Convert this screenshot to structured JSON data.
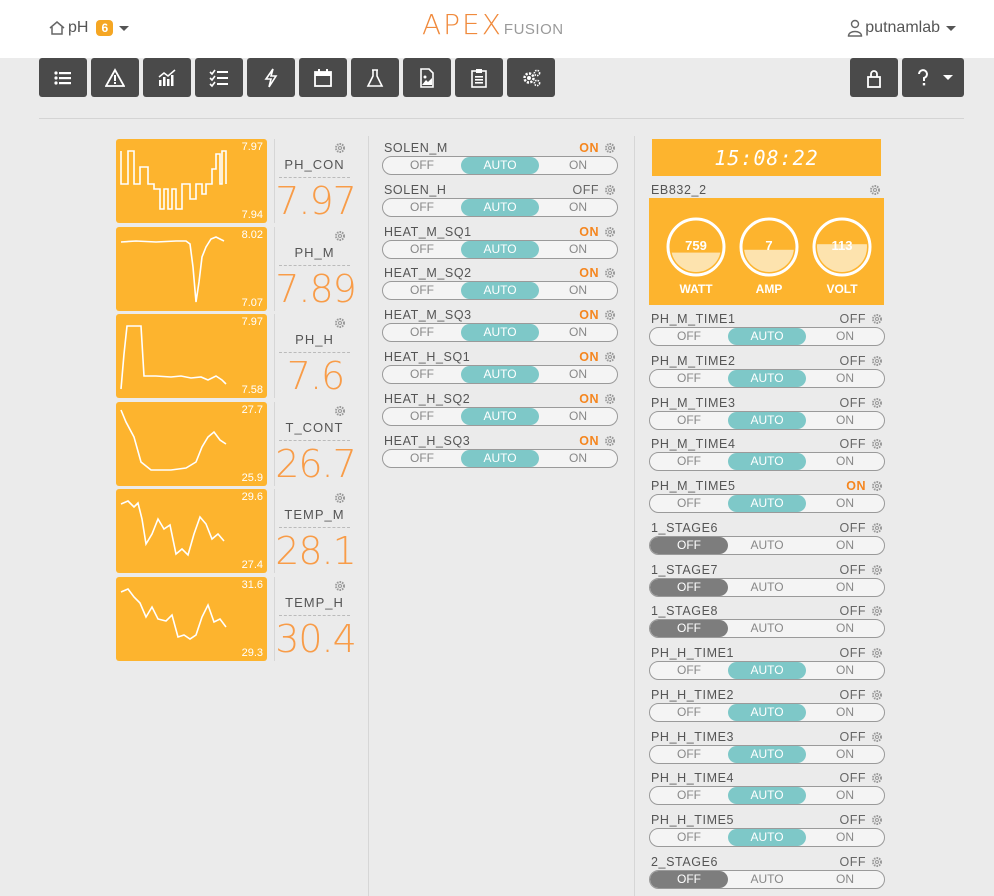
{
  "nav": {
    "site_name": "pH",
    "alert_count": "6",
    "logo_main": "APEX",
    "logo_sub": "FUSION",
    "username": "putnamlab"
  },
  "toolbar": {
    "left_icons": [
      "list-icon",
      "warning-icon",
      "chart-icon",
      "checklist-icon",
      "bolt-icon",
      "calendar-icon",
      "flask-icon",
      "document-image-icon",
      "clipboard-icon",
      "cogs-icon"
    ],
    "right_icons": [
      "lock-icon",
      "help-icon"
    ]
  },
  "probes": [
    {
      "name": "PH_CON",
      "value": "7.97",
      "max": "7.97",
      "min": "7.94"
    },
    {
      "name": "PH_M",
      "value": "7.89",
      "max": "8.02",
      "min": "7.07"
    },
    {
      "name": "PH_H",
      "value": "7.6",
      "max": "7.97",
      "min": "7.58"
    },
    {
      "name": "T_CONT",
      "value": "26.7",
      "max": "27.7",
      "min": "25.9"
    },
    {
      "name": "TEMP_M",
      "value": "28.1",
      "max": "29.6",
      "min": "27.4"
    },
    {
      "name": "TEMP_H",
      "value": "30.4",
      "max": "31.6",
      "min": "29.3"
    }
  ],
  "switch_labels": {
    "off": "OFF",
    "auto": "AUTO",
    "on": "ON"
  },
  "outlets_middle": [
    {
      "name": "SOLEN_M",
      "state": "ON",
      "mode": "AUTO"
    },
    {
      "name": "SOLEN_H",
      "state": "OFF",
      "mode": "AUTO"
    },
    {
      "name": "HEAT_M_SQ1",
      "state": "ON",
      "mode": "AUTO"
    },
    {
      "name": "HEAT_M_SQ2",
      "state": "ON",
      "mode": "AUTO"
    },
    {
      "name": "HEAT_M_SQ3",
      "state": "ON",
      "mode": "AUTO"
    },
    {
      "name": "HEAT_H_SQ1",
      "state": "ON",
      "mode": "AUTO"
    },
    {
      "name": "HEAT_H_SQ2",
      "state": "ON",
      "mode": "AUTO"
    },
    {
      "name": "HEAT_H_SQ3",
      "state": "ON",
      "mode": "AUTO"
    }
  ],
  "clock": "15:08:22",
  "eb832": {
    "title": "EB832_2",
    "gauges": [
      {
        "label": "WATT",
        "value": "759",
        "level": 0.4
      },
      {
        "label": "AMP",
        "value": "7",
        "level": 0.45
      },
      {
        "label": "VOLT",
        "value": "113",
        "level": 0.55
      }
    ]
  },
  "outlets_right": [
    {
      "name": "PH_M_TIME1",
      "state": "OFF",
      "mode": "AUTO"
    },
    {
      "name": "PH_M_TIME2",
      "state": "OFF",
      "mode": "AUTO"
    },
    {
      "name": "PH_M_TIME3",
      "state": "OFF",
      "mode": "AUTO"
    },
    {
      "name": "PH_M_TIME4",
      "state": "OFF",
      "mode": "AUTO"
    },
    {
      "name": "PH_M_TIME5",
      "state": "ON",
      "mode": "AUTO"
    },
    {
      "name": "1_STAGE6",
      "state": "OFF",
      "mode": "OFF"
    },
    {
      "name": "1_STAGE7",
      "state": "OFF",
      "mode": "OFF"
    },
    {
      "name": "1_STAGE8",
      "state": "OFF",
      "mode": "OFF"
    },
    {
      "name": "PH_H_TIME1",
      "state": "OFF",
      "mode": "AUTO"
    },
    {
      "name": "PH_H_TIME2",
      "state": "OFF",
      "mode": "AUTO"
    },
    {
      "name": "PH_H_TIME3",
      "state": "OFF",
      "mode": "AUTO"
    },
    {
      "name": "PH_H_TIME4",
      "state": "OFF",
      "mode": "AUTO"
    },
    {
      "name": "PH_H_TIME5",
      "state": "OFF",
      "mode": "AUTO"
    },
    {
      "name": "2_STAGE6",
      "state": "OFF",
      "mode": "OFF"
    }
  ],
  "colors": {
    "tile": "#fdb42e",
    "on_text": "#f5861f",
    "auto_active": "#7ec8c8",
    "off_active": "#7d7d7d",
    "toolbar_button": "#4a4a4a"
  }
}
